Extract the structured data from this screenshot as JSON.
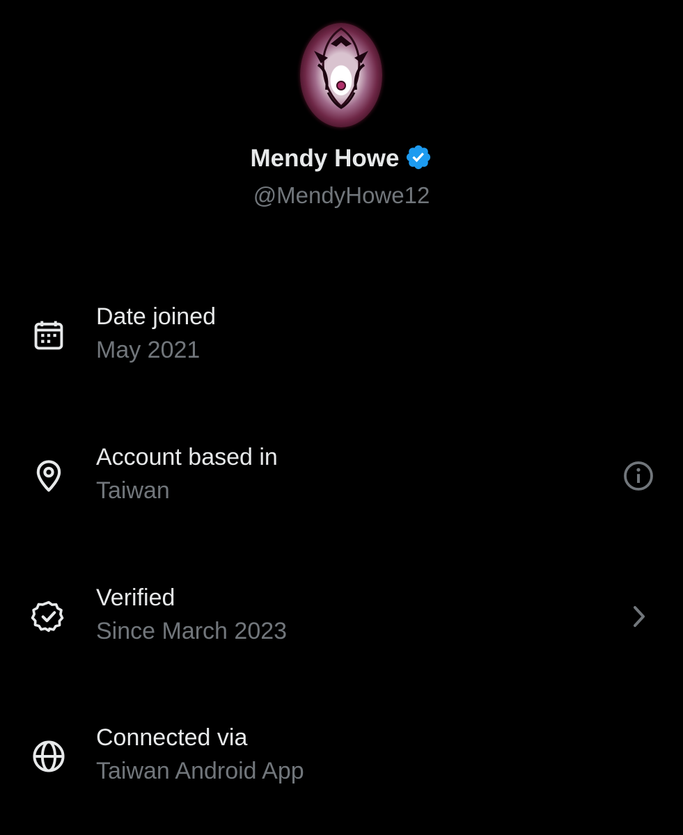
{
  "profile": {
    "name": "Mendy Howe",
    "handle": "@MendyHowe12",
    "verified_badge_icon": "verified-check-icon",
    "badge_color": "#1d9bf0"
  },
  "rows": [
    {
      "title": "Date joined",
      "value": "May 2021",
      "icon": "calendar-icon"
    },
    {
      "title": "Account based in",
      "value": "Taiwan",
      "icon": "location-pin-icon",
      "action_icon": "info-icon"
    },
    {
      "title": "Verified",
      "value": "Since March 2023",
      "icon": "verified-badge-outline-icon",
      "action_icon": "chevron-right-icon"
    },
    {
      "title": "Connected via",
      "value": "Taiwan Android App",
      "icon": "globe-icon"
    }
  ],
  "colors": {
    "background": "#000000",
    "primary_text": "#e7e9ea",
    "secondary_text": "#71767b"
  }
}
